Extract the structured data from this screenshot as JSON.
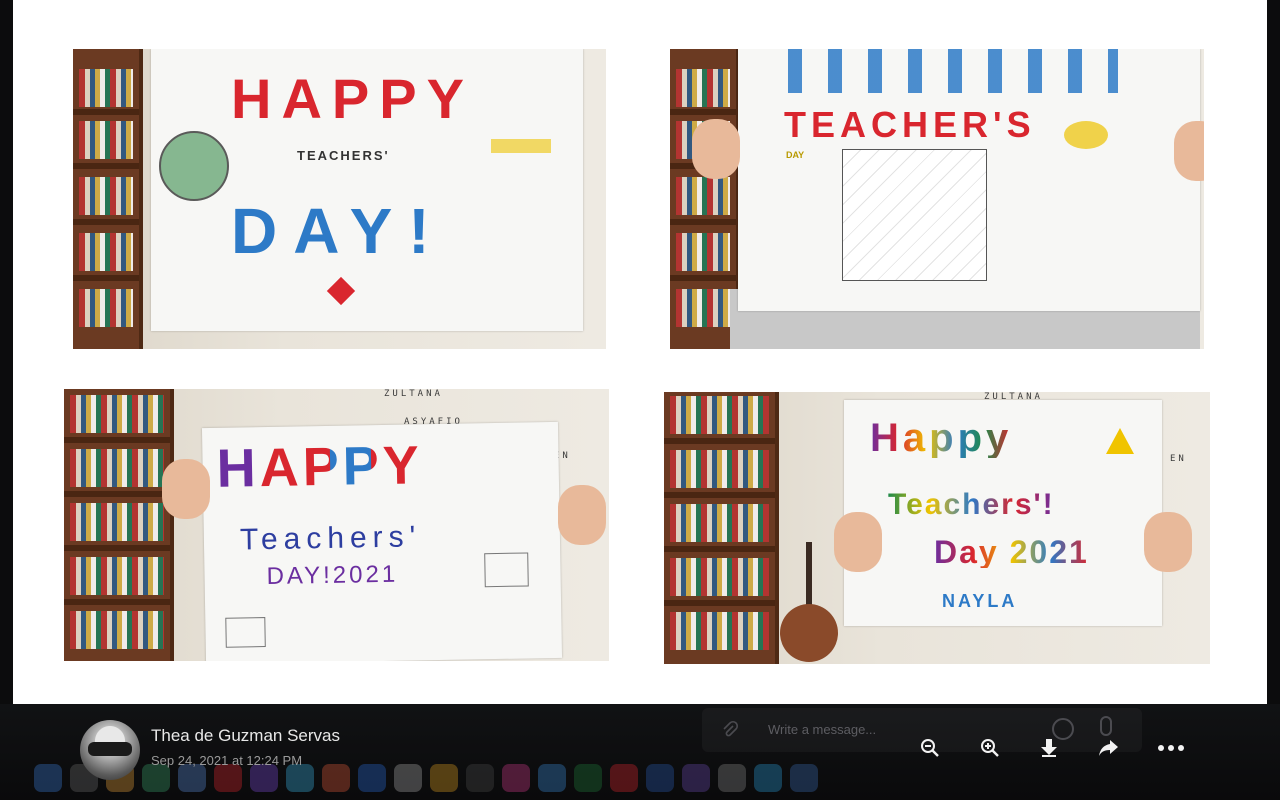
{
  "post": {
    "author": "Thea de Guzman Servas",
    "timestamp": "Sep 24, 2021 at 12:24 PM"
  },
  "composer": {
    "placeholder": "Write a message..."
  },
  "toolbar": {
    "zoom_out_icon": "zoom-out-icon",
    "zoom_in_icon": "zoom-in-icon",
    "download_icon": "download-icon",
    "share_icon": "share-icon",
    "more_icon": "more-icon"
  },
  "photo": {
    "tiles": [
      {
        "lines": [
          "HAPPY",
          "TEACHERS'",
          "DAY!"
        ]
      },
      {
        "lines": [
          "TEACHER'S",
          "DAY"
        ]
      },
      {
        "lines": [
          "HAPPY",
          "Teachers'",
          "DAY!2021"
        ],
        "wall": [
          "ZULTANA",
          "ASYAFIQ",
          "EN"
        ]
      },
      {
        "lines": [
          "Happy",
          "Teachers'!",
          "Day 2021",
          "NAYLA"
        ],
        "wall": [
          "ZULTANA",
          "EN"
        ]
      }
    ]
  },
  "colors": {
    "background": "#0c0c0d",
    "frame": "#ffffff",
    "red": "#d9262e",
    "blue": "#2d7ac7",
    "purple": "#6b2ea0",
    "yellow": "#f0c400"
  }
}
